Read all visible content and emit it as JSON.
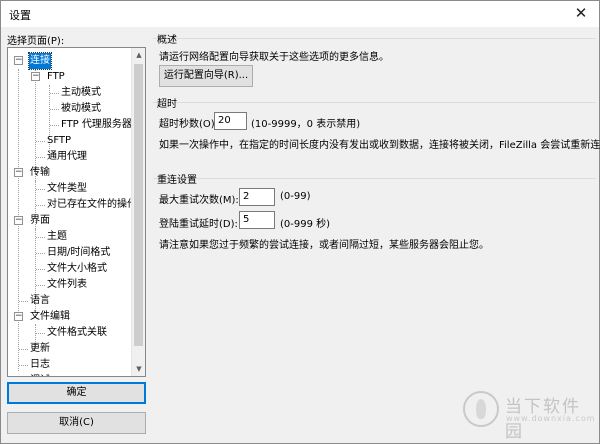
{
  "window": {
    "title": "设置",
    "close_glyph": "✕"
  },
  "sidebar": {
    "label": "选择页面(P):",
    "tree": [
      {
        "label": "连接",
        "expander": "−",
        "selected": true
      },
      {
        "label": "FTP",
        "expander": "−"
      },
      {
        "label": "主动模式"
      },
      {
        "label": "被动模式"
      },
      {
        "label": "FTP 代理服务器"
      },
      {
        "label": "SFTP"
      },
      {
        "label": "通用代理"
      },
      {
        "label": "传输",
        "expander": "−"
      },
      {
        "label": "文件类型"
      },
      {
        "label": "对已存在文件的操作"
      },
      {
        "label": "界面",
        "expander": "−"
      },
      {
        "label": "主题"
      },
      {
        "label": "日期/时间格式"
      },
      {
        "label": "文件大小格式"
      },
      {
        "label": "文件列表"
      },
      {
        "label": "语言"
      },
      {
        "label": "文件编辑",
        "expander": "−"
      },
      {
        "label": "文件格式关联"
      },
      {
        "label": "更新"
      },
      {
        "label": "日志"
      },
      {
        "label": "调试"
      }
    ],
    "scroll_up": "▲",
    "scroll_down": "▼"
  },
  "buttons": {
    "ok": "确定",
    "cancel": "取消(C)"
  },
  "overview": {
    "title": "概述",
    "text": "请运行网络配置向导获取关于这些选项的更多信息。",
    "wizard_button": "运行配置向导(R)..."
  },
  "timeout": {
    "title": "超时",
    "label": "超时秒数(O):",
    "value": "20",
    "hint": "(10-9999，0 表示禁用)",
    "description": "如果一次操作中，在指定的时间长度内没有发出或收到数据，连接将被关闭，FileZilla 会尝试重新连接。"
  },
  "reconnect": {
    "title": "重连设置",
    "max_retries_label": "最大重试次数(M):",
    "max_retries_value": "2",
    "max_retries_hint": "(0-99)",
    "delay_label": "登陆重试延时(D):",
    "delay_value": "5",
    "delay_hint": "(0-999 秒)",
    "note": "请注意如果您过于频繁的尝试连接，或者间隔过短，某些服务器会阻止您。"
  },
  "watermark": {
    "cn": "当下软件园",
    "en": "www.downxia.com",
    "icon": "leaf-logo"
  },
  "colors": {
    "selection": "#0078d7",
    "default_button_border": "#0078d7"
  }
}
